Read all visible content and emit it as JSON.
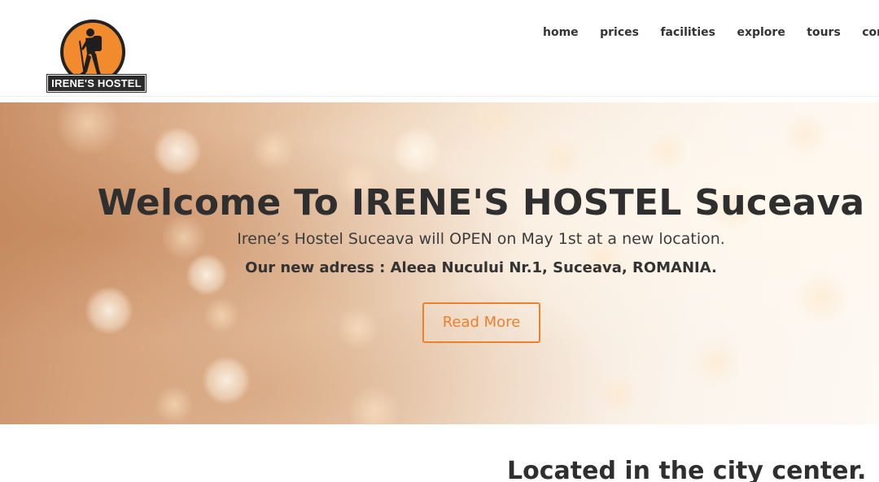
{
  "header": {
    "logo_text": "IRENE'S HOSTEL",
    "logo_colors": {
      "circle": "#f28a2e",
      "outline": "#222222",
      "label_bg": "#2b2b2b"
    },
    "nav": [
      {
        "label": "home"
      },
      {
        "label": "prices"
      },
      {
        "label": "facilities"
      },
      {
        "label": "explore"
      },
      {
        "label": "tours"
      },
      {
        "label": "contact"
      }
    ]
  },
  "hero": {
    "title": "Welcome To IRENE'S HOSTEL Suceava",
    "subtitle": "Irene’s Hostel Suceava will OPEN on May 1st at a new location.",
    "address": "Our new adress : Aleea Nucului Nr.1, Suceava, ROMANIA.",
    "button_label": "Read More",
    "accent_color": "#e8822f"
  },
  "section": {
    "title": "Located in the city center."
  }
}
